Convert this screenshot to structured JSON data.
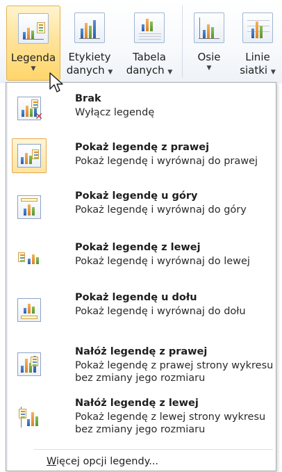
{
  "ribbon": {
    "buttons": [
      {
        "id": "legenda",
        "label": "Legenda",
        "has_arrow": true,
        "active": true
      },
      {
        "id": "etykiety",
        "label_line1": "Etykiety",
        "label_line2": "danych"
      },
      {
        "id": "tabela",
        "label_line1": "Tabela",
        "label_line2": "danych"
      },
      {
        "id": "osie",
        "label": "Osie",
        "has_arrow": true
      },
      {
        "id": "linie",
        "label_line1": "Linie",
        "label_line2": "siatki"
      }
    ]
  },
  "menu": {
    "items": [
      {
        "title": "Brak",
        "description": "Wyłącz legendę",
        "icon": "legend-none-icon"
      },
      {
        "title": "Pokaż legendę z prawej",
        "description": "Pokaż legendę i wyrównaj do prawej",
        "icon": "legend-right-icon",
        "selected": true
      },
      {
        "title": "Pokaż legendę u góry",
        "description": "Pokaż legendę i wyrównaj do góry",
        "icon": "legend-top-icon"
      },
      {
        "title": "Pokaż legendę z lewej",
        "description": "Pokaż legendę i wyrównaj do lewej",
        "icon": "legend-left-icon"
      },
      {
        "title": "Pokaż legendę u dołu",
        "description": "Pokaż legendę i wyrównaj do dołu",
        "icon": "legend-bottom-icon"
      },
      {
        "title": "Nałóż legendę z prawej",
        "description": "Pokaż legendę z prawej strony wykresu bez zmiany jego rozmiaru",
        "icon": "legend-overlay-right-icon"
      },
      {
        "title": "Nałóż legendę z lewej",
        "description": "Pokaż legendę z lewej strony wykresu bez zmiany jego rozmiaru",
        "icon": "legend-overlay-left-icon"
      }
    ],
    "more_options": "Więcej opcji legendy..."
  },
  "colors": {
    "accent_active": "#ffd66b",
    "accent_border": "#e3b04e",
    "menu_border": "#a7abb0"
  }
}
